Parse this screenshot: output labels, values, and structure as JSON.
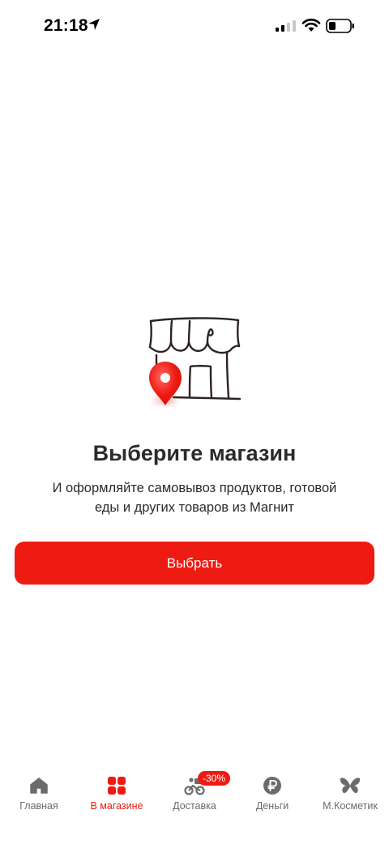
{
  "status": {
    "time": "21:18"
  },
  "main": {
    "title": "Выберите магазин",
    "subtitle": "И оформляйте самовывоз продуктов, готовой еды и других товаров из Магнит",
    "button_label": "Выбрать"
  },
  "nav": {
    "items": [
      {
        "label": "Главная",
        "icon": "home-icon"
      },
      {
        "label": "В магазине",
        "icon": "store-grid-icon",
        "active": true
      },
      {
        "label": "Доставка",
        "icon": "courier-bike-icon",
        "badge": "-30%"
      },
      {
        "label": "Деньги",
        "icon": "ruble-coin-icon"
      },
      {
        "label": "М.Косметик",
        "icon": "butterfly-icon"
      }
    ]
  },
  "colors": {
    "accent": "#ee1b12",
    "text": "#2b2b2b",
    "muted": "#6b6b6b"
  }
}
